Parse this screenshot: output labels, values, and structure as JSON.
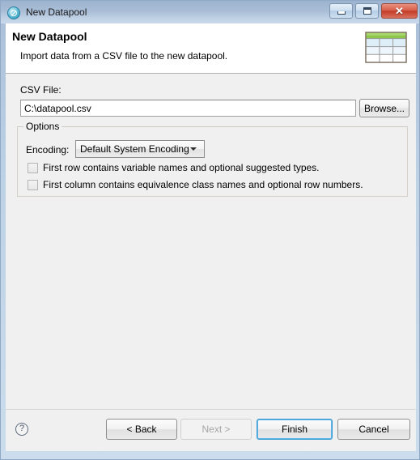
{
  "window": {
    "title": "New Datapool",
    "icon": "datapool-circle-icon",
    "controls": {
      "minimize": "minimize-icon",
      "maximize": "maximize-icon",
      "close": "✕"
    }
  },
  "header": {
    "title": "New Datapool",
    "description": "Import data from a CSV file to the new datapool.",
    "image": "datapool-table-banner-icon"
  },
  "form": {
    "csv_file_label": "CSV File:",
    "csv_file_value": "C:\\datapool.csv",
    "csv_file_placeholder": "",
    "browse_label": "Browse..."
  },
  "options": {
    "group_label": "Options",
    "encoding_label": "Encoding:",
    "encoding_value": "Default System Encoding",
    "encoding_options": [
      "Default System Encoding"
    ],
    "checkboxes": [
      {
        "label": "First row contains variable names and optional suggested types.",
        "checked": false
      },
      {
        "label": "First column contains equivalence class names and optional row numbers.",
        "checked": false
      }
    ]
  },
  "footer": {
    "help_glyph": "?",
    "buttons": [
      {
        "label": "< Back",
        "state": "enabled"
      },
      {
        "label": "Next >",
        "state": "disabled"
      },
      {
        "label": "Finish",
        "state": "default"
      },
      {
        "label": "Cancel",
        "state": "enabled"
      }
    ]
  },
  "colors": {
    "titlebar_top": "#9cb3cf",
    "titlebar_bottom": "#cbdaeb",
    "dialog_bg": "#f0f0f0",
    "header_bg": "#ffffff",
    "focus_ring": "#3c9ad6",
    "close_button": "#c23c28",
    "banner_green": "#7cba3d"
  }
}
